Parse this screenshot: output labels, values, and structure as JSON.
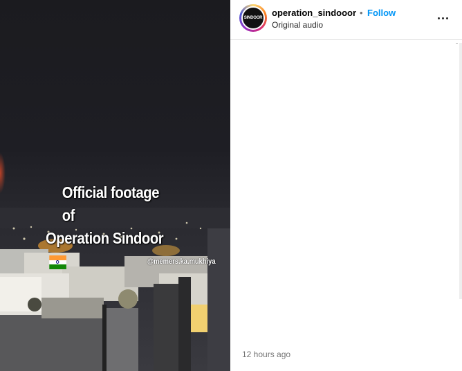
{
  "media": {
    "caption_line1": "Official footage of",
    "caption_line2": "Operation Sindoor",
    "flag_icon": "india-flag-emoji",
    "watermark": "@memers.ka.mukhiya"
  },
  "header": {
    "avatar_text_top": "SINDOOR",
    "avatar_text_mark": "O",
    "username": "operation_sindooor",
    "separator": "•",
    "follow_label": "Follow",
    "audio_label": "Original audio",
    "more_icon": "more-horizontal-icon"
  },
  "footer": {
    "timestamp": "12 hours ago"
  },
  "colors": {
    "follow_blue": "#0095f6",
    "flag_saffron": "#ff9933",
    "flag_green": "#138808"
  }
}
